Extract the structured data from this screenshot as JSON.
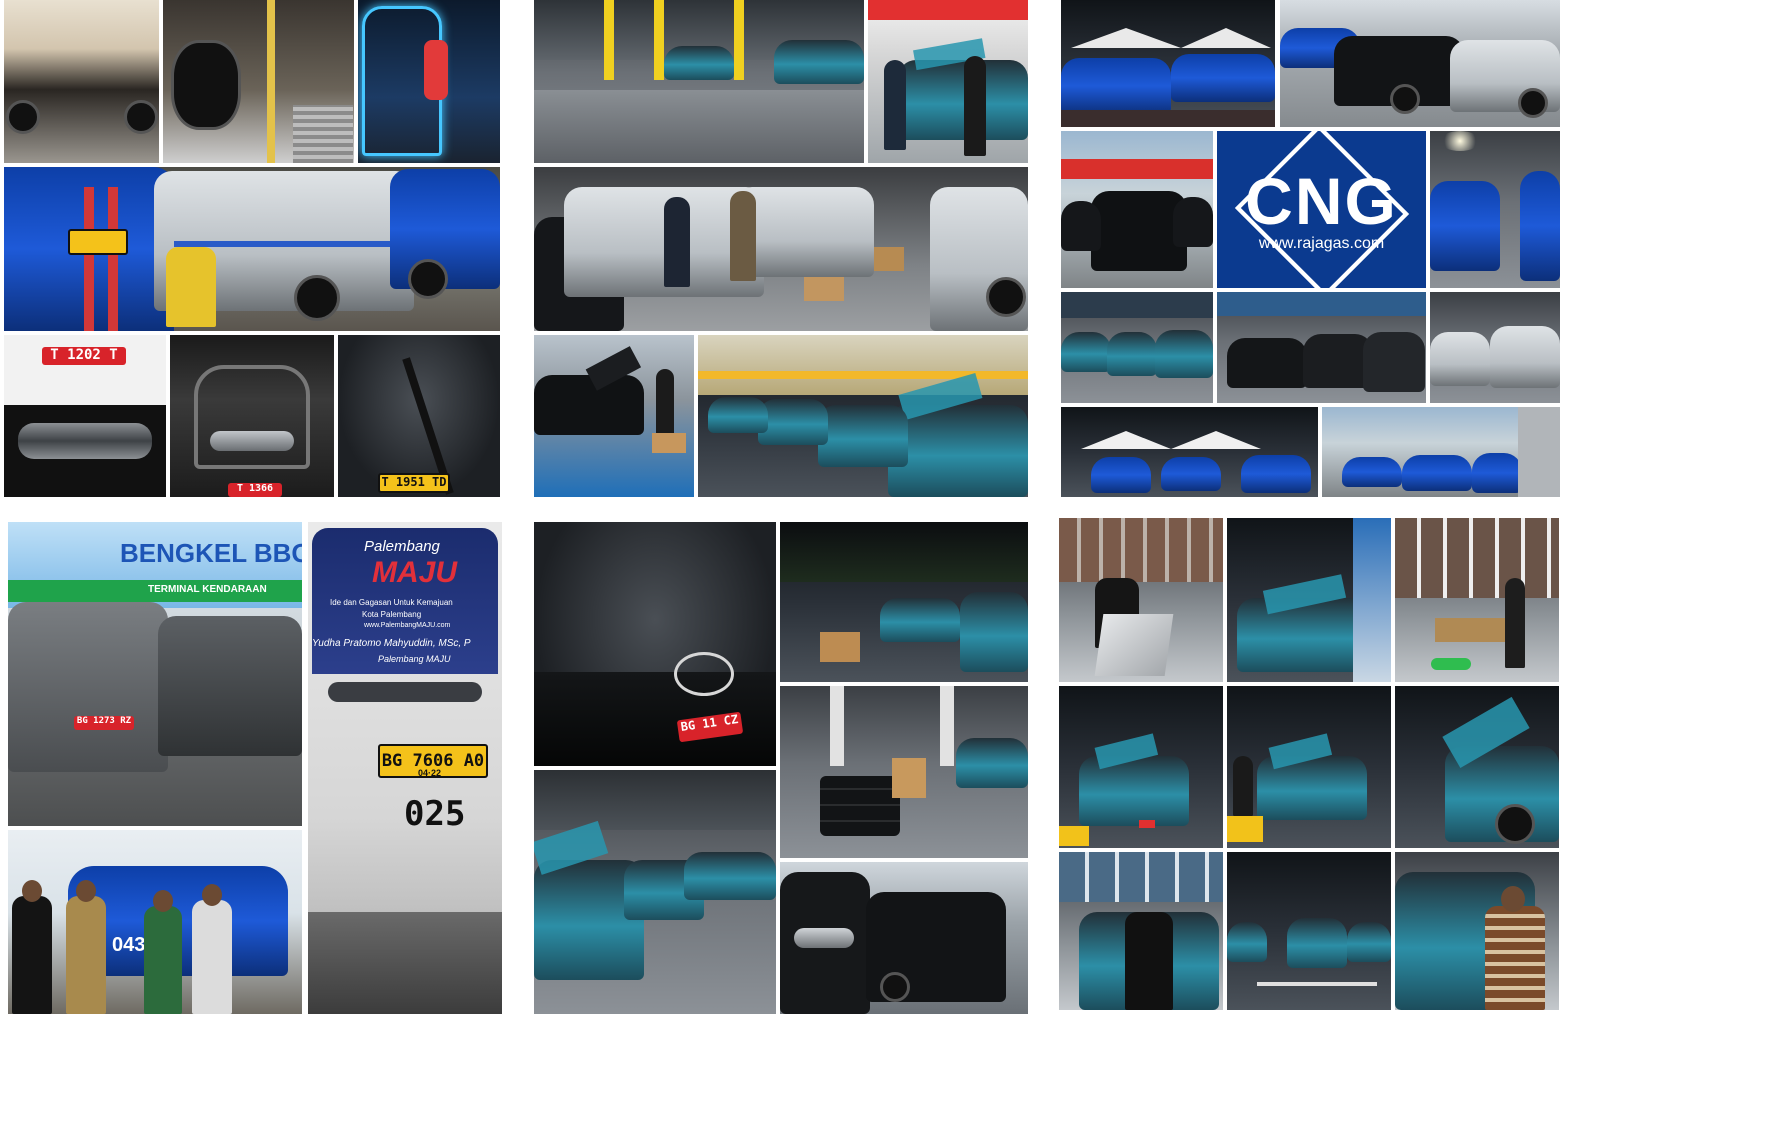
{
  "collage": {
    "cng_sign": {
      "title": "CNG",
      "url": "www.rajagas.com",
      "bg": "#0b3a8f"
    },
    "bengkel_sign": {
      "text": "BENGKEL BBG",
      "sub": "TERMINAL KENDARAAN"
    },
    "bus_sign": {
      "city": "Palembang",
      "brand": "MAJU",
      "line1": "Ide dan Gagasan Untuk Kemajuan",
      "line2": "Kota Palembang",
      "web": "www.PalembangMAJU.com",
      "person": "Yudha Pratomo Mahyuddin, MSc, P",
      "tagline": "Palembang MAJU"
    },
    "plates": {
      "p1": "T 1202 T",
      "p2": "T 1951 TD",
      "p3": "T 1366",
      "p4": "BG 1273 RZ",
      "p5": "BG 7606 A0",
      "p6": "04·22",
      "p7": "025",
      "p8": "BG 11 CZ",
      "p9": "043"
    },
    "colors": {
      "taxi_blue": "#1e5ad8",
      "taxi_teal": "#2c9ab3",
      "plate_red": "#d8232a",
      "plate_yellow": "#f4c21a"
    }
  }
}
